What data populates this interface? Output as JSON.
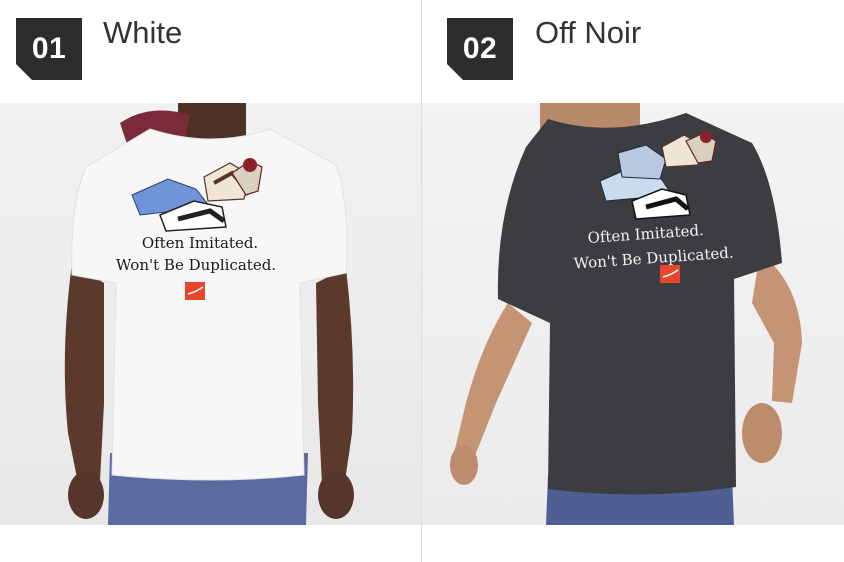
{
  "products": [
    {
      "number": "01",
      "color_name": "White",
      "shirt_color": "#f7f7f7",
      "print_line1": "Often Imitated.",
      "print_line2": "Won't Be Duplicated."
    },
    {
      "number": "02",
      "color_name": "Off Noir",
      "shirt_color": "#3b3d40",
      "print_line1": "Often Imitated.",
      "print_line2": "Won't Be Duplicated."
    }
  ]
}
